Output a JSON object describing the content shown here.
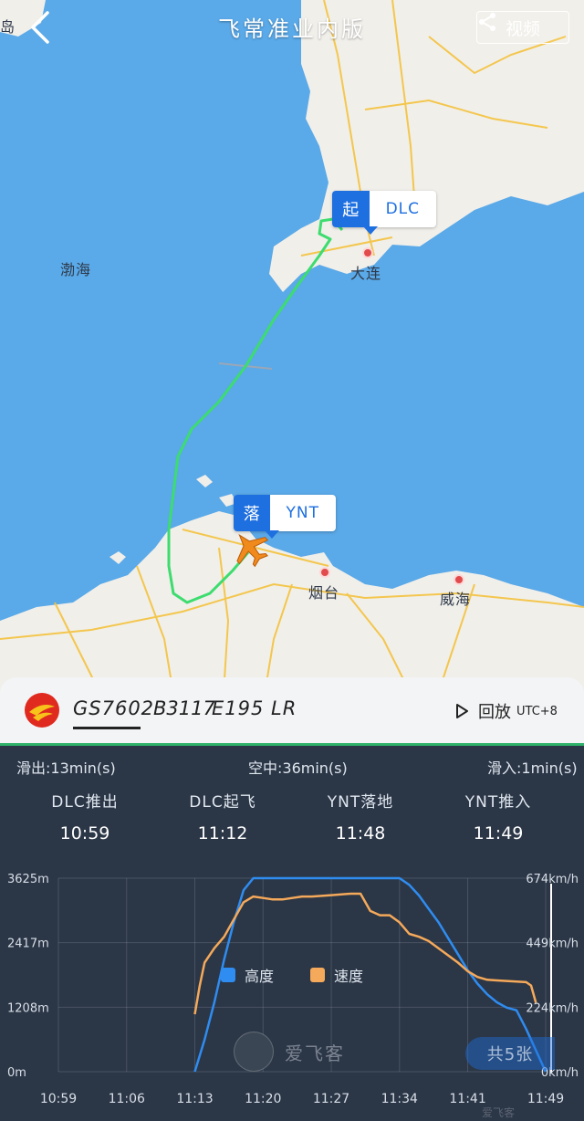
{
  "header": {
    "title": "飞常准业内版",
    "video_label": "视频",
    "left_edge_label": "岛"
  },
  "map": {
    "sea_labels": [
      "渤海"
    ],
    "cities": [
      "大连",
      "烟台",
      "威海"
    ],
    "departure": {
      "type_label": "起",
      "code": "DLC"
    },
    "arrival": {
      "type_label": "落",
      "code": "YNT"
    },
    "colors": {
      "sea": "#5aa9e8",
      "land": "#f1efea",
      "route": "#3ddc6f",
      "road": "#f4c23d"
    }
  },
  "flight": {
    "number": "GS7602",
    "registration": "B3117",
    "aircraft_type": "E195 LR",
    "replay_label": "回放",
    "timezone": "UTC+8"
  },
  "stats": {
    "taxi_out": "滑出:13min(s)",
    "airborne": "空中:36min(s)",
    "taxi_in": "滑入:1min(s)",
    "phases": [
      {
        "label": "DLC推出",
        "time": "10:59"
      },
      {
        "label": "DLC起飞",
        "time": "11:12"
      },
      {
        "label": "YNT落地",
        "time": "11:48"
      },
      {
        "label": "YNT推入",
        "time": "11:49"
      }
    ]
  },
  "chart_data": {
    "type": "line",
    "x_ticks": [
      "10:59",
      "11:06",
      "11:13",
      "11:20",
      "11:27",
      "11:34",
      "11:41",
      "11:49"
    ],
    "y_left_ticks": [
      "0m",
      "1208m",
      "2417m",
      "3625m"
    ],
    "y_right_ticks": [
      "0km/h",
      "224km/h",
      "449km/h",
      "674km/h"
    ],
    "ylim_left": [
      0,
      3625
    ],
    "ylim_right": [
      0,
      674
    ],
    "series": [
      {
        "name": "高度",
        "color": "#2f8cf0",
        "axis": "left",
        "x_minutes": [
          14,
          15,
          16,
          17,
          18,
          19,
          20,
          21,
          22,
          24,
          26,
          28,
          30,
          32,
          34,
          35,
          36,
          37,
          38,
          39,
          40,
          41,
          42,
          43,
          44,
          45,
          46,
          47,
          48,
          49,
          50
        ],
        "values": [
          0,
          600,
          1300,
          2100,
          2800,
          3400,
          3625,
          3625,
          3625,
          3625,
          3625,
          3625,
          3625,
          3625,
          3625,
          3625,
          3500,
          3300,
          3050,
          2800,
          2500,
          2200,
          1900,
          1650,
          1450,
          1300,
          1200,
          1150,
          800,
          400,
          0
        ]
      },
      {
        "name": "速度",
        "color": "#f5a95a",
        "axis": "right",
        "x_minutes": [
          14,
          14.5,
          15,
          16,
          17,
          18,
          19,
          20,
          21,
          22,
          23,
          24,
          25,
          26,
          28,
          30,
          31,
          32,
          33,
          34,
          35,
          36,
          37,
          38,
          39,
          40,
          41,
          42,
          43,
          44,
          45,
          46,
          47,
          48,
          48.5,
          49
        ],
        "values": [
          200,
          300,
          380,
          430,
          470,
          530,
          590,
          610,
          605,
          600,
          600,
          605,
          610,
          610,
          615,
          620,
          620,
          560,
          545,
          545,
          520,
          480,
          470,
          455,
          430,
          405,
          380,
          350,
          330,
          320,
          318,
          316,
          314,
          312,
          300,
          240
        ]
      }
    ],
    "xlabel": "",
    "ylabel": ""
  },
  "overlay": {
    "watermark": "爱飞客",
    "photo_count": "共5张",
    "bottom_brand": "爱飞客"
  }
}
